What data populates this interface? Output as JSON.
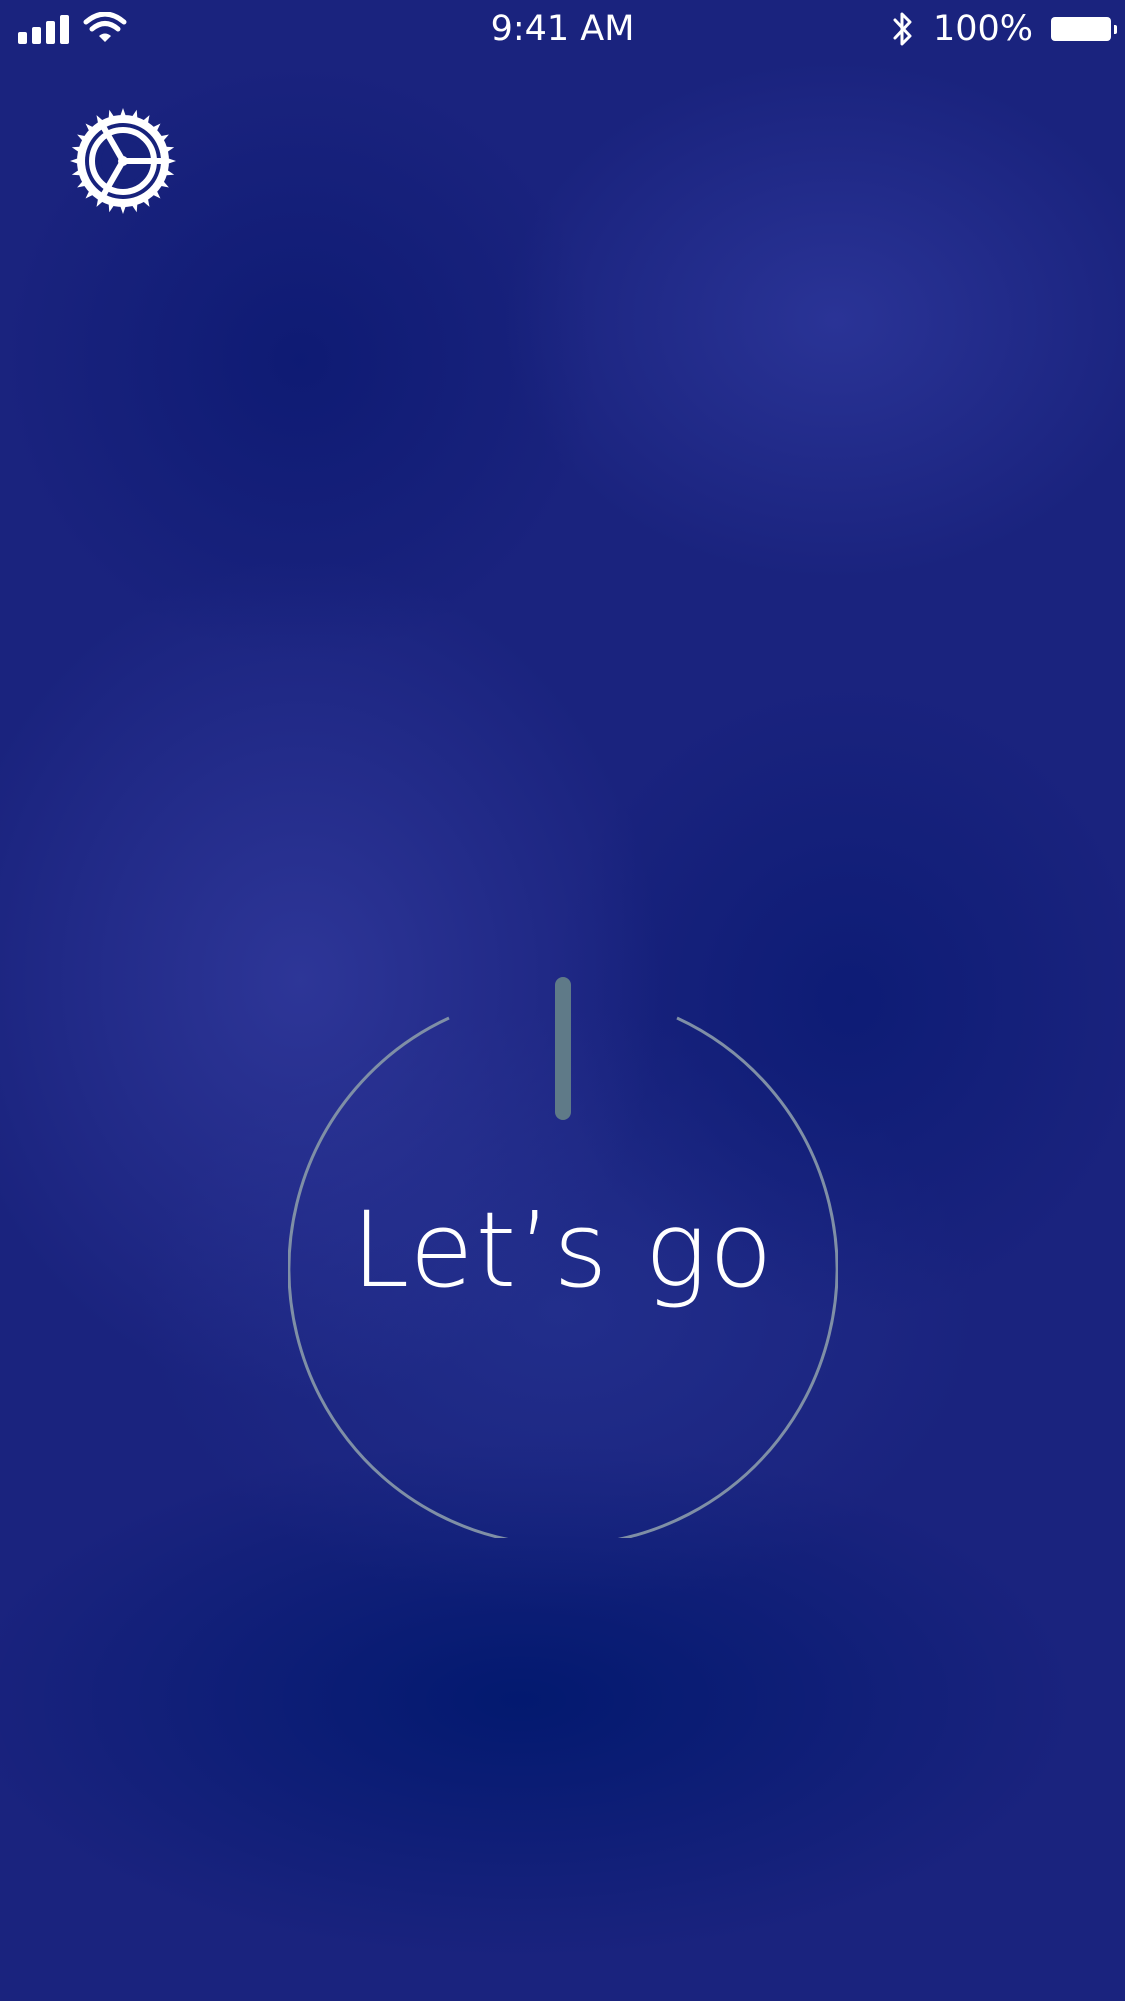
{
  "status_bar": {
    "time": "9:41 AM",
    "battery_percent": "100%",
    "signal_bars": 4,
    "icons": [
      "signal-icon",
      "wifi-icon",
      "bluetooth-icon",
      "battery-icon"
    ]
  },
  "header": {
    "settings_icon": "gear-icon"
  },
  "main": {
    "power_button_label": "Let’s go",
    "power_icon": "power-icon"
  },
  "colors": {
    "background": "#1a237e",
    "background_dark": "#0a1a6e",
    "foreground": "#ffffff",
    "power_ring": "#7f8fa6",
    "power_bar": "#5f7a88"
  }
}
